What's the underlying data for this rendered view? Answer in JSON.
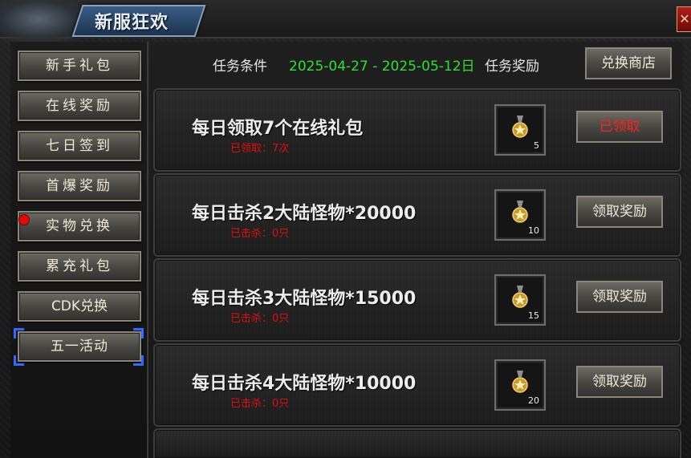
{
  "window": {
    "title": "新服狂欢",
    "close_label": "✕"
  },
  "sidebar": {
    "items": [
      {
        "label": "新手礼包"
      },
      {
        "label": "在线奖励"
      },
      {
        "label": "七日签到"
      },
      {
        "label": "首爆奖励"
      },
      {
        "label": "实物兑换",
        "has_notification": true
      },
      {
        "label": "累充礼包"
      },
      {
        "label": "CDK兑换"
      },
      {
        "label": "五一活动",
        "selected": true
      }
    ]
  },
  "header": {
    "condition_label": "任务条件",
    "date_range": "2025-04-27 - 2025-05-12日",
    "reward_label": "任务奖励",
    "shop_button": "兑换商店"
  },
  "tasks": [
    {
      "title": "每日领取7个在线礼包",
      "progress": "已领取：7次",
      "reward_count": "5",
      "button": "已领取",
      "claimed": true
    },
    {
      "title": "每日击杀2大陆怪物*20000",
      "progress": "已击杀：0只",
      "reward_count": "10",
      "button": "领取奖励",
      "claimed": false
    },
    {
      "title": "每日击杀3大陆怪物*15000",
      "progress": "已击杀：0只",
      "reward_count": "15",
      "button": "领取奖励",
      "claimed": false
    },
    {
      "title": "每日击杀4大陆怪物*10000",
      "progress": "已击杀：0只",
      "reward_count": "20",
      "button": "领取奖励",
      "claimed": false
    }
  ],
  "colors": {
    "date_green": "#2fe02f",
    "progress_red": "#e01010",
    "claimed_red": "#ff2020",
    "selection_blue": "#2d6cff"
  },
  "icons": {
    "reward": "gold-medal-icon",
    "notification": "red-dot-icon",
    "close": "close-icon"
  }
}
